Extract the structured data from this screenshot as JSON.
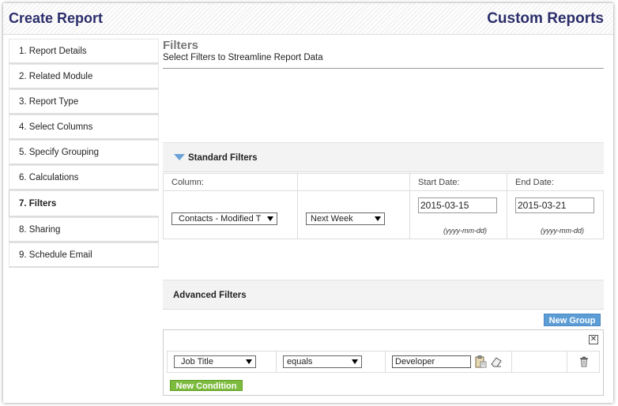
{
  "header": {
    "title": "Create Report",
    "module_title": "Custom Reports"
  },
  "sidebar": {
    "items": [
      {
        "label": "1. Report Details"
      },
      {
        "label": "2. Related Module"
      },
      {
        "label": "3. Report Type"
      },
      {
        "label": "4. Select Columns"
      },
      {
        "label": "5. Specify Grouping"
      },
      {
        "label": "6. Calculations"
      },
      {
        "label": "7. Filters",
        "active": true
      },
      {
        "label": "8. Sharing"
      },
      {
        "label": "9. Schedule Email"
      }
    ]
  },
  "section": {
    "title": "Filters",
    "subtitle": "Select Filters to Streamline Report Data"
  },
  "standard_filters": {
    "title": "Standard Filters",
    "col_header_column": "Column:",
    "col_header_start": "Start Date:",
    "col_header_end": "End Date:",
    "column_value": "Contacts - Modified T",
    "period_value": "Next Week",
    "start_date": "2015-03-15",
    "end_date": "2015-03-21",
    "date_format_hint": "(yyyy-mm-dd)"
  },
  "advanced_filters": {
    "title": "Advanced Filters",
    "new_group_label": "New Group",
    "new_condition_label": "New Condition",
    "condition": {
      "field": "Job Title",
      "operator": "equals",
      "value": "Developer"
    }
  },
  "colors": {
    "title": "#2b2e6b",
    "blue_button": "#5d9dd6",
    "green_button": "#7dbb3e"
  },
  "icons": [
    "chevron-down-icon",
    "dropdown-arrow-icon",
    "clipboard-icon",
    "eraser-icon",
    "trash-icon",
    "close-box-icon"
  ]
}
